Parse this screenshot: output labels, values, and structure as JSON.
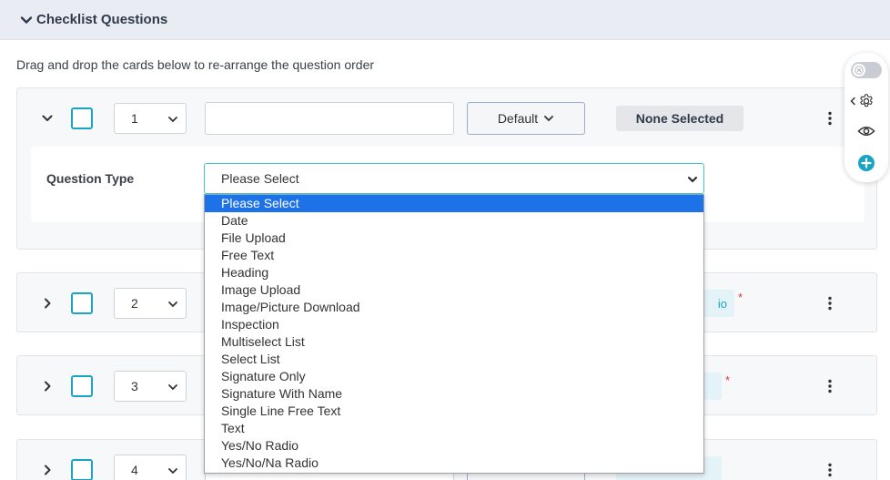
{
  "section": {
    "title": "Checklist Questions"
  },
  "instructions": "Drag and drop the cards below to re-arrange the question order",
  "question_type": {
    "label": "Question Type",
    "selected": "Please Select",
    "options": [
      "Please Select",
      "Date",
      "File Upload",
      "Free Text",
      "Heading",
      "Image Upload",
      "Image/Picture Download",
      "Inspection",
      "Multiselect List",
      "Select List",
      "Signature Only",
      "Signature With Name",
      "Single Line Free Text",
      "Text",
      "Yes/No Radio",
      "Yes/No/Na Radio"
    ]
  },
  "cards": [
    {
      "number": "1",
      "default_label": "Default",
      "assignee": "None Selected"
    },
    {
      "number": "2",
      "badge_fragment": "io",
      "required": "*"
    },
    {
      "number": "3",
      "required": "*"
    },
    {
      "number": "4"
    }
  ],
  "colors": {
    "accent": "#1ba3c6",
    "selected_option": "#1e72e8",
    "required": "#e53935",
    "add_button": "#1ba3c6"
  },
  "icons": {
    "collapse": "chevron-down-icon",
    "expand": "chevron-right-icon",
    "kebab": "vertical-dots-icon",
    "settings": "gear-icon",
    "preview": "eye-icon",
    "add": "plus-circle-icon"
  }
}
